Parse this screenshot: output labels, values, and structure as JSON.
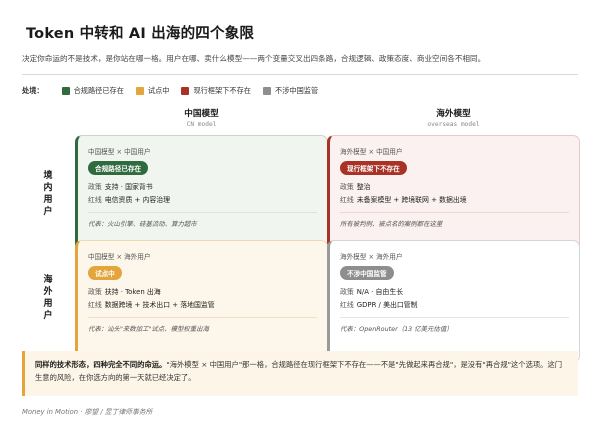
{
  "title": "Token 中转和 AI 出海的四个象限",
  "subtitle": "决定你命运的不是技术，是你站在哪一格。用户在哪、卖什么模型——两个变量交叉出四条路，合规逻辑、政策态度、商业空间各不相同。",
  "legend": {
    "title": "处境：",
    "items": [
      {
        "label": "合规路径已存在",
        "color": "#2f6b3f"
      },
      {
        "label": "试点中",
        "color": "#e3a53c"
      },
      {
        "label": "现行框架下不存在",
        "color": "#a83226"
      },
      {
        "label": "不涉中国监管",
        "color": "#8e8e8e"
      }
    ]
  },
  "columns": [
    {
      "zh": "中国模型",
      "en": "CN model"
    },
    {
      "zh": "海外模型",
      "en": "overseas model"
    }
  ],
  "rows": [
    {
      "label": "境内用户"
    },
    {
      "label": "海外用户"
    }
  ],
  "cells": {
    "cn_cn": {
      "tags": "中国模型 × 中国用户",
      "badge": "合规路径已存在",
      "color": "#2f6b3f",
      "policy_key": "政策",
      "policy_val": "支持 · 国家背书",
      "redline_key": "红线",
      "redline_val": "电信资质 + 内容治理",
      "example": "代表：火山引擎、硅基流动、算力超市"
    },
    "ov_cn": {
      "tags": "海外模型 × 中国用户",
      "badge": "现行框架下不存在",
      "color": "#a83226",
      "policy_key": "政策",
      "policy_val": "整治",
      "redline_key": "红线",
      "redline_val": "未备案模型 + 跨境联网 + 数据出境",
      "example": "所有被判例、被点名的案例都在这里"
    },
    "cn_ov": {
      "tags": "中国模型 × 海外用户",
      "badge": "试点中",
      "color": "#e3a53c",
      "policy_key": "政策",
      "policy_val": "扶持 · Token 出海",
      "redline_key": "红线",
      "redline_val": "数据跨境 + 技术出口 + 落地国监管",
      "example": "代表：汕头\"来数加工\"试点、模型权重出海"
    },
    "ov_ov": {
      "tags": "海外模型 × 海外用户",
      "badge": "不涉中国监管",
      "color": "#8e8e8e",
      "policy_key": "政策",
      "policy_val": "N/A · 自由生长",
      "redline_key": "红线",
      "redline_val": "GDPR / 美出口管制",
      "example": "代表：OpenRouter（13 亿美元估值）"
    }
  },
  "note": {
    "lead": "同样的技术形态，四种完全不同的命运。",
    "body": "\"海外模型 × 中国用户\"那一格，合规路径在现行框架下不存在——不是\"先做起来再合规\"，是没有\"再合规\"这个选项。这门生意的风险，在你选方向的第一天就已经决定了。"
  },
  "footer": "Money in Motion · 廖望 / 昱丁律师事务所"
}
